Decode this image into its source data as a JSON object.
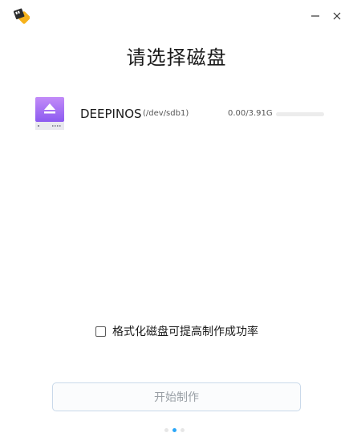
{
  "window": {
    "minimize_icon": "minimize-icon",
    "close_icon": "close-icon"
  },
  "title": "请选择磁盘",
  "disk": {
    "name": "DEEPINOS",
    "path": "(/dev/sdb1)",
    "size": "0.00/3.91G",
    "usage_fraction": 0.0,
    "icon": "usb-drive-eject-icon",
    "colors": {
      "gradient_top": "#c38cf8",
      "gradient_bottom": "#8c5bf0",
      "base": "#e9e9ef"
    }
  },
  "format_option": {
    "label": "格式化磁盘可提高制作成功率",
    "checked": false
  },
  "start_button": {
    "label": "开始制作"
  },
  "pagination": {
    "total": 3,
    "current": 2
  },
  "colors": {
    "accent": "#2ca7f8"
  }
}
